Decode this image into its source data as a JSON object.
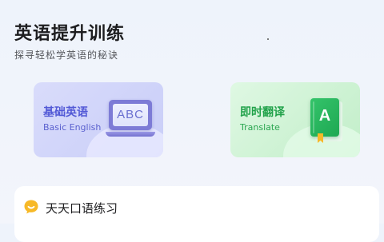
{
  "header": {
    "title": "英语提升训练",
    "subtitle": "探寻轻松学英语的秘诀"
  },
  "cards": [
    {
      "title": "基础英语",
      "subtitle": "Basic English",
      "icon": "laptop-abc-icon",
      "icon_text": "ABC",
      "accent": "#5259d6"
    },
    {
      "title": "即时翻译",
      "subtitle": "Translate",
      "icon": "green-book-icon",
      "icon_text": "A",
      "accent": "#21a24a"
    }
  ],
  "practice": {
    "title": "天天口语练习",
    "icon": "chat-bubble-icon",
    "icon_color": "#f7b928"
  }
}
